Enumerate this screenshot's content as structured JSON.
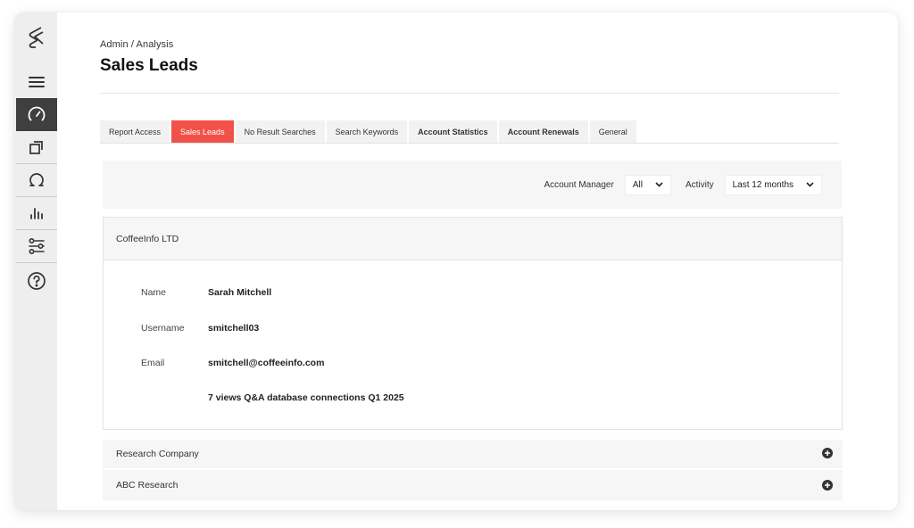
{
  "breadcrumb": "Admin / Analysis",
  "page_title": "Sales Leads",
  "sidebar": {
    "logo": "brand-logo-icon",
    "items": [
      {
        "icon": "hamburger-menu-icon",
        "active": false
      },
      {
        "icon": "dashboard-gauge-icon",
        "active": true
      },
      {
        "icon": "copy-windows-icon",
        "active": false
      },
      {
        "icon": "omega-icon",
        "active": false
      },
      {
        "icon": "bar-chart-icon",
        "active": false
      },
      {
        "icon": "sliders-icon",
        "active": false
      },
      {
        "icon": "help-icon",
        "active": false
      }
    ]
  },
  "tabs": [
    {
      "label": "Report Access",
      "active": false,
      "bold": false
    },
    {
      "label": "Sales Leads",
      "active": true,
      "bold": false
    },
    {
      "label": "No Result Searches",
      "active": false,
      "bold": false
    },
    {
      "label": "Search Keywords",
      "active": false,
      "bold": false
    },
    {
      "label": "Account Statistics",
      "active": false,
      "bold": true
    },
    {
      "label": "Account Renewals",
      "active": false,
      "bold": true
    },
    {
      "label": "General",
      "active": false,
      "bold": false
    }
  ],
  "filters": {
    "account_manager_label": "Account Manager",
    "account_manager_value": "All",
    "activity_label": "Activity",
    "activity_value": "Last 12 months"
  },
  "lead": {
    "company": "CoffeeInfo LTD",
    "name_label": "Name",
    "name": "Sarah Mitchell",
    "username_label": "Username",
    "username": "smitchell03",
    "email_label": "Email",
    "email": "smitchell@coffeeinfo.com",
    "activity": "7 views Q&A database connections Q1 2025"
  },
  "collapsed_leads": [
    {
      "company": "Research Company"
    },
    {
      "company": "ABC Research"
    }
  ],
  "colors": {
    "accent": "#f2514a",
    "sidebar_bg": "#eeeeee",
    "sidebar_active": "#3f3f3f"
  }
}
